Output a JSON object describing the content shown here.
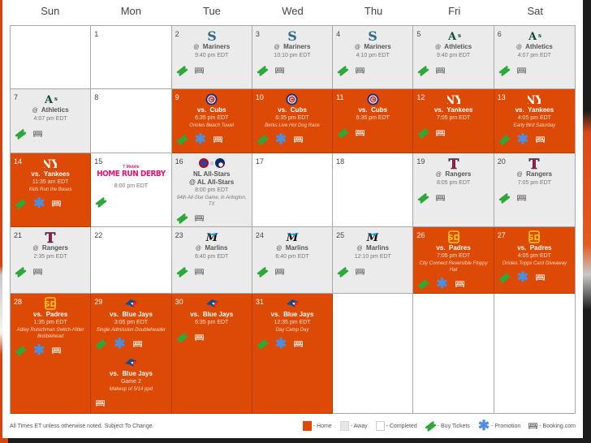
{
  "calendar": {
    "weekdays": [
      "Sun",
      "Mon",
      "Tue",
      "Wed",
      "Thu",
      "Fri",
      "Sat"
    ],
    "days": [
      {
        "day": "",
        "type": "empty"
      },
      {
        "day": "1",
        "type": "completed"
      },
      {
        "day": "2",
        "type": "away",
        "logo": "mariners-logo",
        "prefix": "@",
        "opponent": "Mariners",
        "time": "9:40 pm EDT",
        "tickets": true,
        "promotion": false,
        "booking": true
      },
      {
        "day": "3",
        "type": "away",
        "logo": "mariners-logo",
        "prefix": "@",
        "opponent": "Mariners",
        "time": "10:10 pm EDT",
        "tickets": true,
        "promotion": false,
        "booking": true
      },
      {
        "day": "4",
        "type": "away",
        "logo": "mariners-logo",
        "prefix": "@",
        "opponent": "Mariners",
        "time": "4:10 pm EDT",
        "tickets": true,
        "promotion": false,
        "booking": true
      },
      {
        "day": "5",
        "type": "away",
        "logo": "athletics-logo",
        "prefix": "@",
        "opponent": "Athletics",
        "time": "9:40 pm EDT",
        "tickets": true,
        "promotion": false,
        "booking": true
      },
      {
        "day": "6",
        "type": "away",
        "logo": "athletics-logo",
        "prefix": "@",
        "opponent": "Athletics",
        "time": "4:07 pm EDT",
        "tickets": true,
        "promotion": false,
        "booking": true
      },
      {
        "day": "7",
        "type": "away",
        "logo": "athletics-logo",
        "prefix": "@",
        "opponent": "Athletics",
        "time": "4:07 pm EDT",
        "tickets": true,
        "promotion": false,
        "booking": true
      },
      {
        "day": "8",
        "type": "completed"
      },
      {
        "day": "9",
        "type": "home",
        "logo": "cubs-logo",
        "prefix": "vs.",
        "opponent": "Cubs",
        "time": "6:35 pm EDT",
        "promo": "Orioles Beach Towel",
        "tickets": true,
        "promotion": true,
        "booking": true
      },
      {
        "day": "10",
        "type": "home",
        "logo": "cubs-logo",
        "prefix": "vs.",
        "opponent": "Cubs",
        "time": "6:35 pm EDT",
        "promo": "Berks Live Hot Dog Race",
        "tickets": true,
        "promotion": true,
        "booking": true
      },
      {
        "day": "11",
        "type": "home",
        "logo": "cubs-logo",
        "prefix": "vs.",
        "opponent": "Cubs",
        "time": "6:35 pm EDT",
        "tickets": true,
        "promotion": false,
        "booking": true
      },
      {
        "day": "12",
        "type": "home",
        "logo": "yankees-logo",
        "prefix": "vs.",
        "opponent": "Yankees",
        "time": "7:05 pm EDT",
        "tickets": true,
        "promotion": false,
        "booking": true
      },
      {
        "day": "13",
        "type": "home",
        "logo": "yankees-logo",
        "prefix": "vs.",
        "opponent": "Yankees",
        "time": "4:05 pm EDT",
        "promo": "Early Bird Saturday",
        "tickets": true,
        "promotion": true,
        "booking": true
      },
      {
        "day": "14",
        "type": "home",
        "logo": "yankees-logo",
        "prefix": "vs.",
        "opponent": "Yankees",
        "time": "11:35 am EDT",
        "promo": "Kids Run the Bases",
        "tickets": true,
        "promotion": true,
        "booking": true
      },
      {
        "day": "15",
        "type": "special",
        "brand": "T Mobile",
        "event": "HOME RUN DERBY",
        "time": "8:00 pm EDT",
        "tickets": true
      },
      {
        "day": "16",
        "type": "away",
        "logo": "allstar-logos",
        "logo_sep": "@",
        "prefix": "",
        "opponent": "NL All-Stars",
        "line2": "@  AL All-Stars",
        "time": "8:00 pm EDT",
        "promo": "94th All-Star Game, in Arlington, TX",
        "tickets": true,
        "promotion": false,
        "booking": true
      },
      {
        "day": "17",
        "type": "completed"
      },
      {
        "day": "18",
        "type": "completed"
      },
      {
        "day": "19",
        "type": "away",
        "logo": "rangers-logo",
        "prefix": "@",
        "opponent": "Rangers",
        "time": "8:05 pm EDT",
        "tickets": true,
        "promotion": false,
        "booking": true
      },
      {
        "day": "20",
        "type": "away",
        "logo": "rangers-logo",
        "prefix": "@",
        "opponent": "Rangers",
        "time": "7:05 pm EDT",
        "tickets": true,
        "promotion": false,
        "booking": true
      },
      {
        "day": "21",
        "type": "away",
        "logo": "rangers-logo",
        "prefix": "@",
        "opponent": "Rangers",
        "time": "2:35 pm EDT",
        "tickets": true,
        "promotion": false,
        "booking": true
      },
      {
        "day": "22",
        "type": "completed"
      },
      {
        "day": "23",
        "type": "away",
        "logo": "marlins-logo",
        "prefix": "@",
        "opponent": "Marlins",
        "time": "6:40 pm EDT",
        "tickets": true,
        "promotion": false,
        "booking": true
      },
      {
        "day": "24",
        "type": "away",
        "logo": "marlins-logo",
        "prefix": "@",
        "opponent": "Marlins",
        "time": "6:40 pm EDT",
        "tickets": true,
        "promotion": false,
        "booking": true
      },
      {
        "day": "25",
        "type": "away",
        "logo": "marlins-logo",
        "prefix": "@",
        "opponent": "Marlins",
        "time": "12:10 pm EDT",
        "tickets": true,
        "promotion": false,
        "booking": true
      },
      {
        "day": "26",
        "type": "home",
        "logo": "padres-logo",
        "prefix": "vs.",
        "opponent": "Padres",
        "time": "7:05 pm EDT",
        "promo": "City Connect Reversible Floppy Hat",
        "tickets": true,
        "promotion": true,
        "booking": true
      },
      {
        "day": "27",
        "type": "home",
        "logo": "padres-logo",
        "prefix": "vs.",
        "opponent": "Padres",
        "time": "4:05 pm EDT",
        "promo": "Orioles Topps Card Giveaway",
        "tickets": true,
        "promotion": true,
        "booking": true
      },
      {
        "day": "28",
        "type": "home",
        "logo": "padres-logo",
        "prefix": "vs.",
        "opponent": "Padres",
        "time": "1:35 pm EDT",
        "promo": "Adley Rutschman Switch-Hitter Bobblehead",
        "tickets": true,
        "promotion": true,
        "booking": true
      },
      {
        "day": "29",
        "type": "home",
        "logo": "bluejays-logo",
        "prefix": "vs.",
        "opponent": "Blue Jays",
        "time": "3:05 pm EDT",
        "promo": "Single Admission Doubleheader",
        "tickets": true,
        "promotion": true,
        "booking": true,
        "second_game": {
          "logo": "bluejays-logo",
          "prefix": "vs.",
          "opponent": "Blue Jays",
          "time": "Game 2",
          "promo": "Makeup of 5/14 ppd",
          "tickets": false,
          "promotion": false,
          "booking": true
        }
      },
      {
        "day": "30",
        "type": "home",
        "logo": "bluejays-logo",
        "prefix": "vs.",
        "opponent": "Blue Jays",
        "time": "6:35 pm EDT",
        "tickets": true,
        "promotion": false,
        "booking": true
      },
      {
        "day": "31",
        "type": "home",
        "logo": "bluejays-logo",
        "prefix": "vs.",
        "opponent": "Blue Jays",
        "time": "12:35 pm EDT",
        "promo": "Day Camp Day",
        "tickets": true,
        "promotion": true,
        "booking": true
      },
      {
        "day": "",
        "type": "empty"
      },
      {
        "day": "",
        "type": "empty"
      },
      {
        "day": "",
        "type": "empty"
      }
    ]
  },
  "legend": {
    "note": "All Times ET unless otherwise noted. Subject To Change.",
    "items": [
      {
        "key": "home",
        "label": "- Home"
      },
      {
        "key": "away",
        "label": "- Away"
      },
      {
        "key": "completed",
        "label": "- Completed"
      },
      {
        "key": "tickets",
        "label": "- Buy Tickets"
      },
      {
        "key": "promotion",
        "label": "- Promotion"
      },
      {
        "key": "booking",
        "label": "- Booking.com"
      }
    ]
  },
  "colors": {
    "home": "#dd4a06",
    "away": "#ebebeb",
    "completed": "#ffffff",
    "ticket": "#2ea83a",
    "promotion": "#4a8fe0",
    "hrd": "#e2146f"
  }
}
